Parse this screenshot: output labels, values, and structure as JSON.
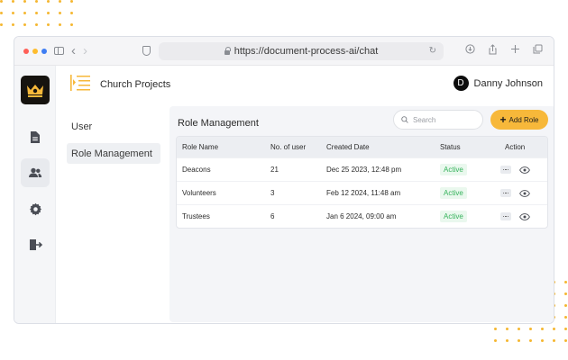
{
  "browser": {
    "url": "https://document-process-ai/chat"
  },
  "header": {
    "project_title": "Church Projects",
    "user_initial": "D",
    "user_name": "Danny Johnson"
  },
  "subnav": {
    "items": [
      {
        "label": "User"
      },
      {
        "label": "Role Management"
      }
    ]
  },
  "panel": {
    "title": "Role Management",
    "search_placeholder": "Search",
    "add_button_label": "Add Role"
  },
  "table": {
    "columns": [
      "Role Name",
      "No. of user",
      "Created Date",
      "Status",
      "Action"
    ],
    "rows": [
      {
        "name": "Deacons",
        "users": "21",
        "date": "Dec 25 2023, 12:48 pm",
        "status": "Active"
      },
      {
        "name": "Volunteers",
        "users": "3",
        "date": "Feb 12 2024, 11:48 am",
        "status": "Active"
      },
      {
        "name": "Trustees",
        "users": "6",
        "date": "Jan 6 2024, 09:00 am",
        "status": "Active"
      }
    ]
  },
  "icons": {
    "rail": [
      "crown-logo-icon",
      "document-icon",
      "users-icon",
      "gear-icon",
      "logout-icon"
    ],
    "row_actions": [
      "more-icon",
      "eye-icon"
    ]
  },
  "colors": {
    "accent": "#f7b83a",
    "status_active": "#36b35c",
    "logo_bg": "#16130f"
  }
}
